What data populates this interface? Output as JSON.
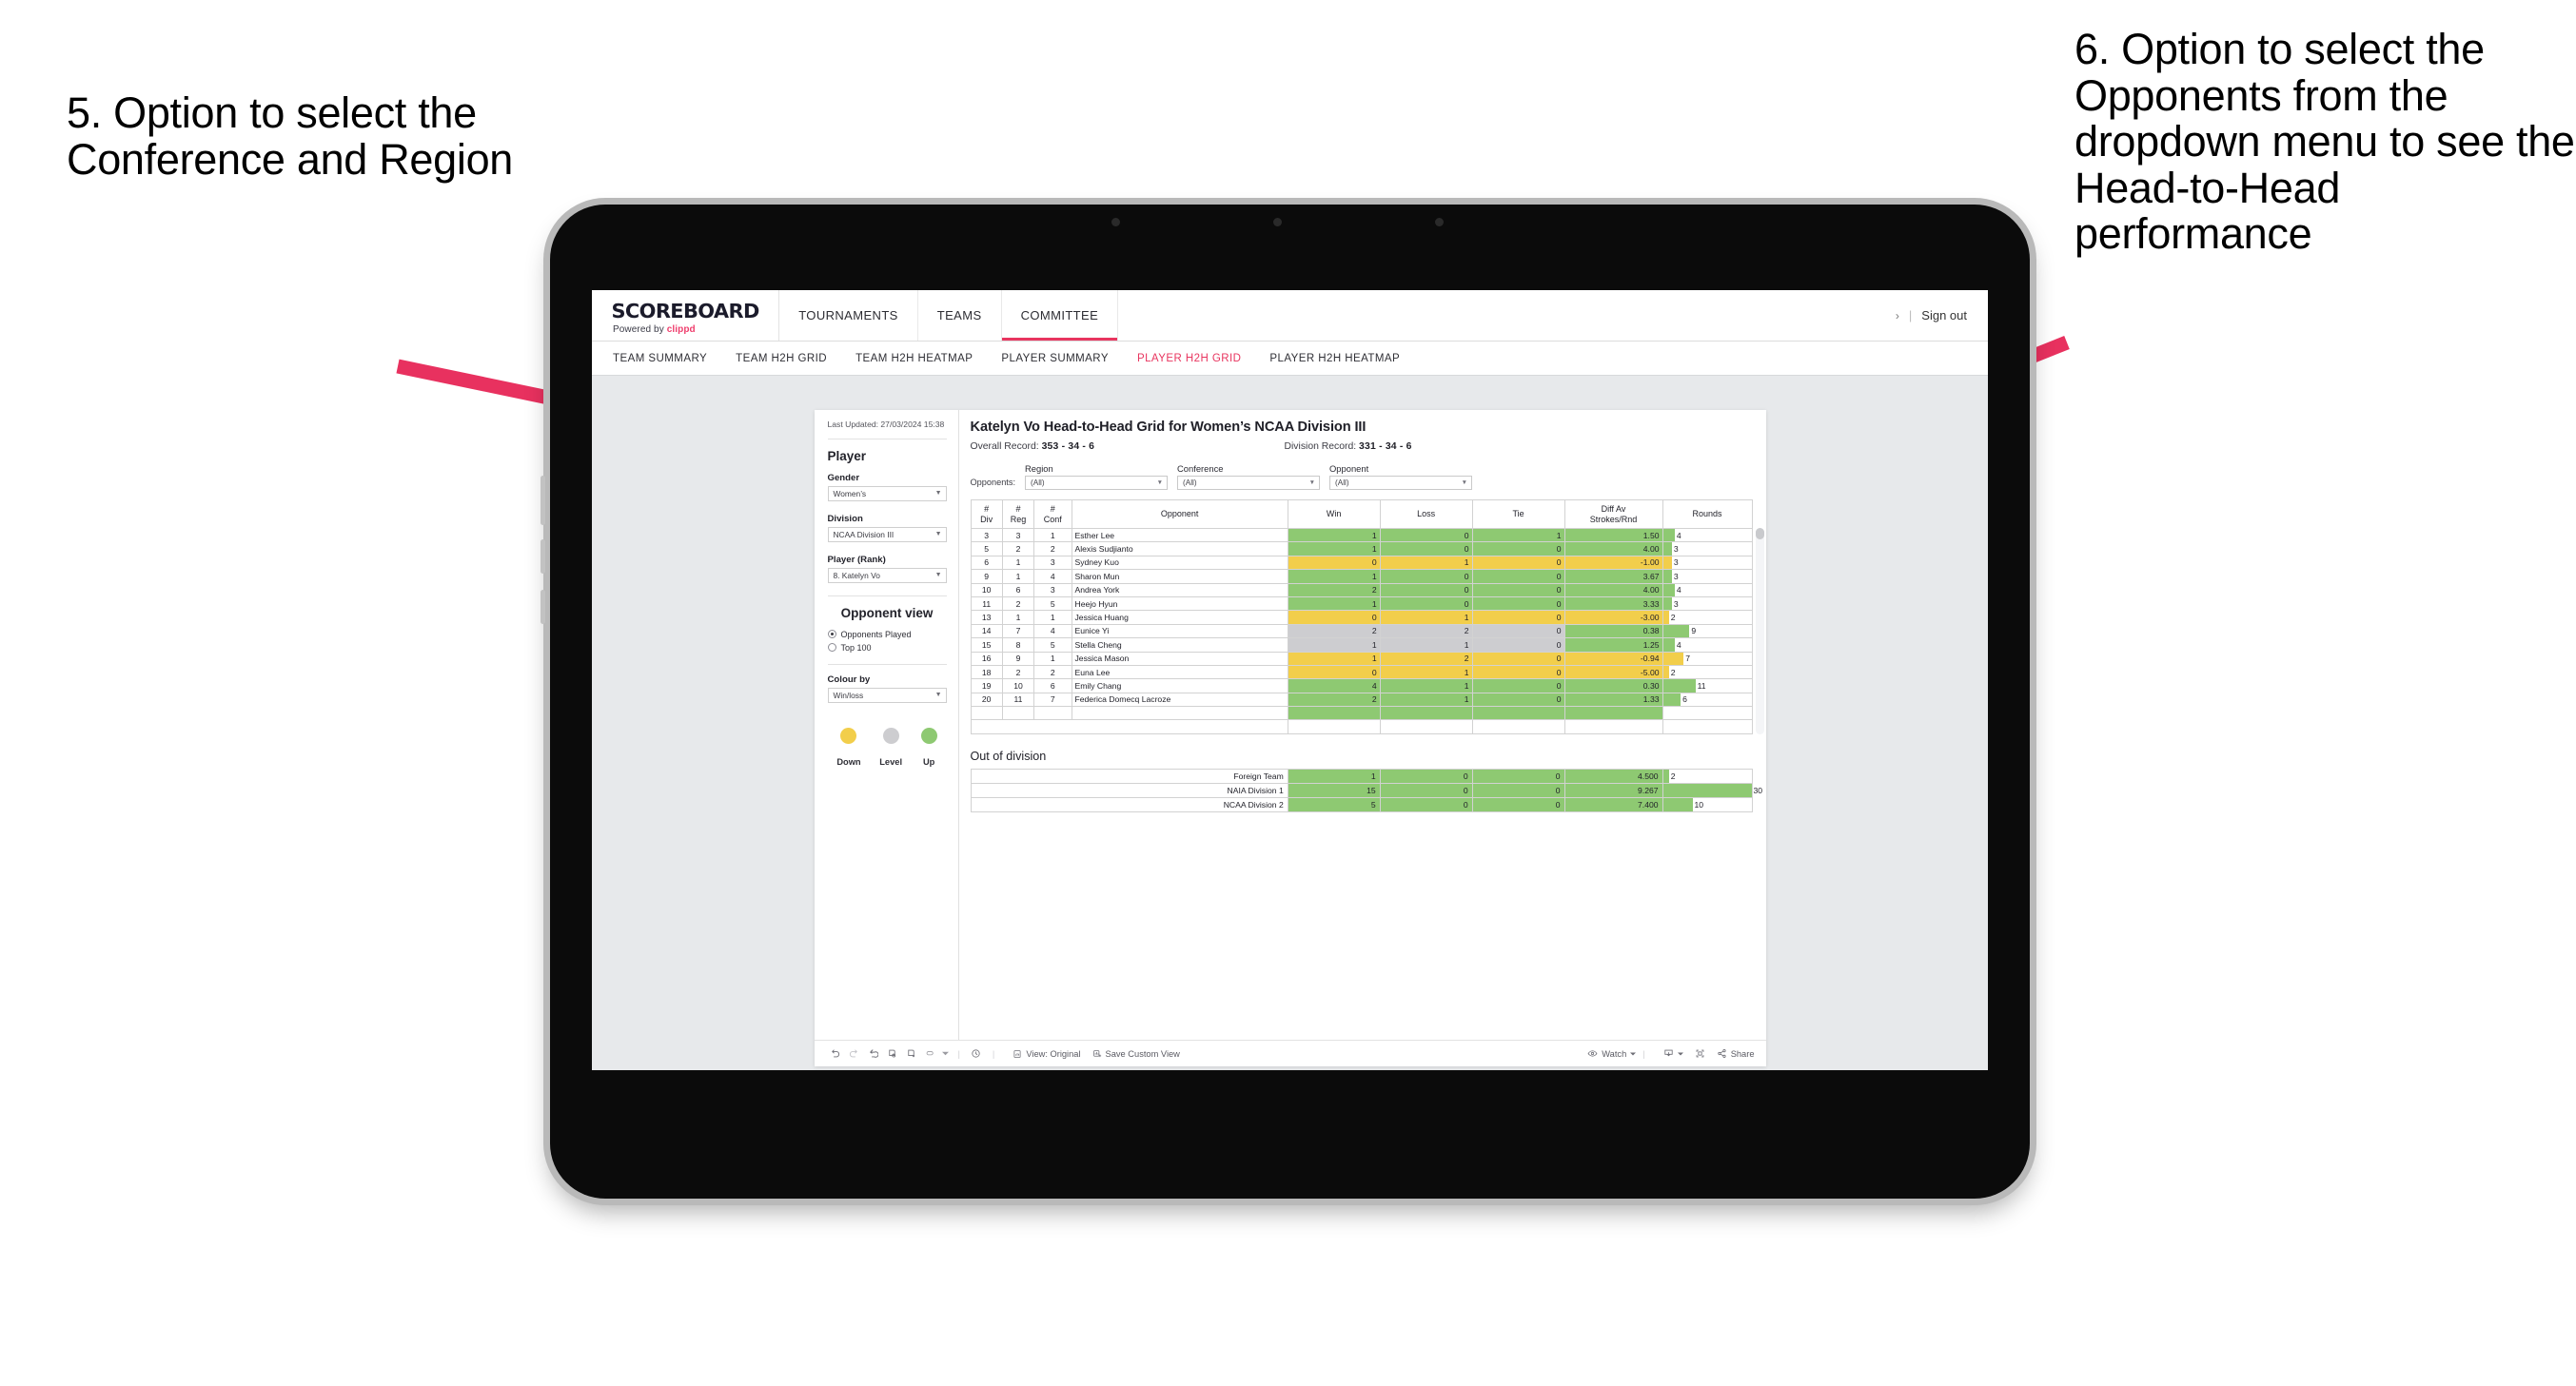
{
  "annotations": {
    "left": "5. Option to select the Conference and Region",
    "right": "6. Option to select the Opponents from the dropdown menu to see the Head-to-Head performance",
    "arrow_color": "#e8315f"
  },
  "topnav": {
    "brand_main": "SCOREBOARD",
    "brand_sub_prefix": "Powered by ",
    "brand_sub_accent": "clippd",
    "tabs": [
      {
        "label": "TOURNAMENTS",
        "active": false
      },
      {
        "label": "TEAMS",
        "active": false
      },
      {
        "label": "COMMITTEE",
        "active": true
      }
    ],
    "chevron": "›",
    "divider": "|",
    "signout": "Sign out"
  },
  "subnav": {
    "items": [
      {
        "label": "TEAM SUMMARY",
        "active": false
      },
      {
        "label": "TEAM H2H GRID",
        "active": false
      },
      {
        "label": "TEAM H2H HEATMAP",
        "active": false
      },
      {
        "label": "PLAYER SUMMARY",
        "active": false
      },
      {
        "label": "PLAYER H2H GRID",
        "active": true
      },
      {
        "label": "PLAYER H2H HEATMAP",
        "active": false
      }
    ]
  },
  "sidebar": {
    "last_updated": "Last Updated: 27/03/2024 15:38",
    "player_heading": "Player",
    "gender_label": "Gender",
    "gender_value": "Women’s",
    "division_label": "Division",
    "division_value": "NCAA Division III",
    "player_rank_label": "Player (Rank)",
    "player_rank_value": "8. Katelyn Vo",
    "opponent_view_heading": "Opponent view",
    "radio_opponents_played": "Opponents Played",
    "radio_top100": "Top 100",
    "colour_by_label": "Colour by",
    "colour_by_value": "Win/loss",
    "legend": [
      {
        "label": "Down",
        "color": "#f2ce4b"
      },
      {
        "label": "Level",
        "color": "#cdcdd0"
      },
      {
        "label": "Up",
        "color": "#8ec972"
      }
    ]
  },
  "main": {
    "title": "Katelyn Vo Head-to-Head Grid for Women’s NCAA Division III",
    "overall_record_label": "Overall Record:",
    "overall_record_value": "353 - 34 - 6",
    "division_record_label": "Division Record:",
    "division_record_value": "331 - 34 - 6",
    "opponents_label": "Opponents:",
    "filters": [
      {
        "label": "Region",
        "value": "(All)"
      },
      {
        "label": "Conference",
        "value": "(All)"
      },
      {
        "label": "Opponent",
        "value": "(All)"
      }
    ]
  },
  "chart_data": {
    "type": "table",
    "title": "Katelyn Vo Head-to-Head Grid for Women’s NCAA Division III",
    "columns": [
      "# Div",
      "# Reg",
      "# Conf",
      "Opponent",
      "Win",
      "Loss",
      "Tie",
      "Diff Av Strokes/Rnd",
      "Rounds"
    ],
    "header_lines": [
      [
        "#",
        "Div"
      ],
      [
        "#",
        "Reg"
      ],
      [
        "#",
        "Conf"
      ],
      [
        "Opponent",
        ""
      ],
      [
        "Win",
        ""
      ],
      [
        "Loss",
        ""
      ],
      [
        "Tie",
        ""
      ],
      [
        "Diff Av",
        "Strokes/Rnd"
      ],
      [
        "Rounds",
        ""
      ]
    ],
    "rounds_max": 30,
    "rows": [
      {
        "div": "3",
        "reg": "3",
        "conf": "1",
        "opponent": "Esther Lee",
        "win": "1",
        "loss": "0",
        "tie": "1",
        "diff": "1.50",
        "rounds": "4",
        "state": "up"
      },
      {
        "div": "5",
        "reg": "2",
        "conf": "2",
        "opponent": "Alexis Sudjianto",
        "win": "1",
        "loss": "0",
        "tie": "0",
        "diff": "4.00",
        "rounds": "3",
        "state": "up"
      },
      {
        "div": "6",
        "reg": "1",
        "conf": "3",
        "opponent": "Sydney Kuo",
        "win": "0",
        "loss": "1",
        "tie": "0",
        "diff": "-1.00",
        "rounds": "3",
        "state": "down"
      },
      {
        "div": "9",
        "reg": "1",
        "conf": "4",
        "opponent": "Sharon Mun",
        "win": "1",
        "loss": "0",
        "tie": "0",
        "diff": "3.67",
        "rounds": "3",
        "state": "up"
      },
      {
        "div": "10",
        "reg": "6",
        "conf": "3",
        "opponent": "Andrea York",
        "win": "2",
        "loss": "0",
        "tie": "0",
        "diff": "4.00",
        "rounds": "4",
        "state": "up"
      },
      {
        "div": "11",
        "reg": "2",
        "conf": "5",
        "opponent": "Heejo Hyun",
        "win": "1",
        "loss": "0",
        "tie": "0",
        "diff": "3.33",
        "rounds": "3",
        "state": "up"
      },
      {
        "div": "13",
        "reg": "1",
        "conf": "1",
        "opponent": "Jessica Huang",
        "win": "0",
        "loss": "1",
        "tie": "0",
        "diff": "-3.00",
        "rounds": "2",
        "state": "down"
      },
      {
        "div": "14",
        "reg": "7",
        "conf": "4",
        "opponent": "Eunice Yi",
        "win": "2",
        "loss": "2",
        "tie": "0",
        "diff": "0.38",
        "rounds": "9",
        "state": "level",
        "diff_state": "up"
      },
      {
        "div": "15",
        "reg": "8",
        "conf": "5",
        "opponent": "Stella Cheng",
        "win": "1",
        "loss": "1",
        "tie": "0",
        "diff": "1.25",
        "rounds": "4",
        "state": "level",
        "diff_state": "up"
      },
      {
        "div": "16",
        "reg": "9",
        "conf": "1",
        "opponent": "Jessica Mason",
        "win": "1",
        "loss": "2",
        "tie": "0",
        "diff": "-0.94",
        "rounds": "7",
        "state": "down"
      },
      {
        "div": "18",
        "reg": "2",
        "conf": "2",
        "opponent": "Euna Lee",
        "win": "0",
        "loss": "1",
        "tie": "0",
        "diff": "-5.00",
        "rounds": "2",
        "state": "down"
      },
      {
        "div": "19",
        "reg": "10",
        "conf": "6",
        "opponent": "Emily Chang",
        "win": "4",
        "loss": "1",
        "tie": "0",
        "diff": "0.30",
        "rounds": "11",
        "state": "up"
      },
      {
        "div": "20",
        "reg": "11",
        "conf": "7",
        "opponent": "Federica Domecq Lacroze",
        "win": "2",
        "loss": "1",
        "tie": "0",
        "diff": "1.33",
        "rounds": "6",
        "state": "up"
      }
    ],
    "out_of_division_title": "Out of division",
    "out_of_division": [
      {
        "opponent": "Foreign Team",
        "win": "1",
        "loss": "0",
        "tie": "0",
        "diff": "4.500",
        "rounds": "2",
        "state": "up"
      },
      {
        "opponent": "NAIA Division 1",
        "win": "15",
        "loss": "0",
        "tie": "0",
        "diff": "9.267",
        "rounds": "30",
        "state": "up"
      },
      {
        "opponent": "NCAA Division 2",
        "win": "5",
        "loss": "0",
        "tie": "0",
        "diff": "7.400",
        "rounds": "10",
        "state": "up"
      }
    ]
  },
  "toolbar": {
    "icons": [
      "undo-icon",
      "redo-icon",
      "revert-icon",
      "refresh-icon",
      "pause-icon",
      "loop-icon"
    ],
    "view_label": "View: Original",
    "save_label": "Save Custom View",
    "watch_label": "Watch",
    "share_label": "Share",
    "separator": "|"
  }
}
